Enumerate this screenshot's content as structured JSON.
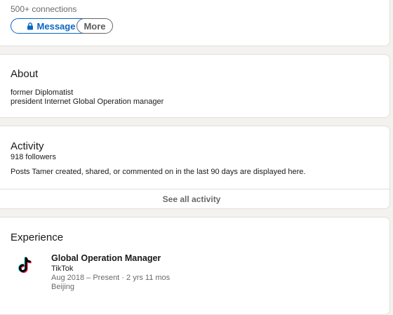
{
  "profile": {
    "connections": "500+ connections",
    "message_label": "Message",
    "more_label": "More"
  },
  "about": {
    "title": "About",
    "lines": [
      "former Diplomatist",
      "president Internet Global Operation manager"
    ]
  },
  "activity": {
    "title": "Activity",
    "followers": "918 followers",
    "description": "Posts Tamer created, shared, or commented on in the last 90 days are displayed here.",
    "see_all_label": "See all activity"
  },
  "experience": {
    "title": "Experience",
    "items": [
      {
        "logo_icon": "tiktok-logo-icon",
        "role": "Global Operation Manager",
        "company": "TikTok",
        "dates": "Aug 2018 – Present · 2 yrs 11 mos",
        "location": "Beijing"
      }
    ]
  },
  "colors": {
    "accent": "#0a66c2",
    "page_bg": "#f3f2ef"
  }
}
